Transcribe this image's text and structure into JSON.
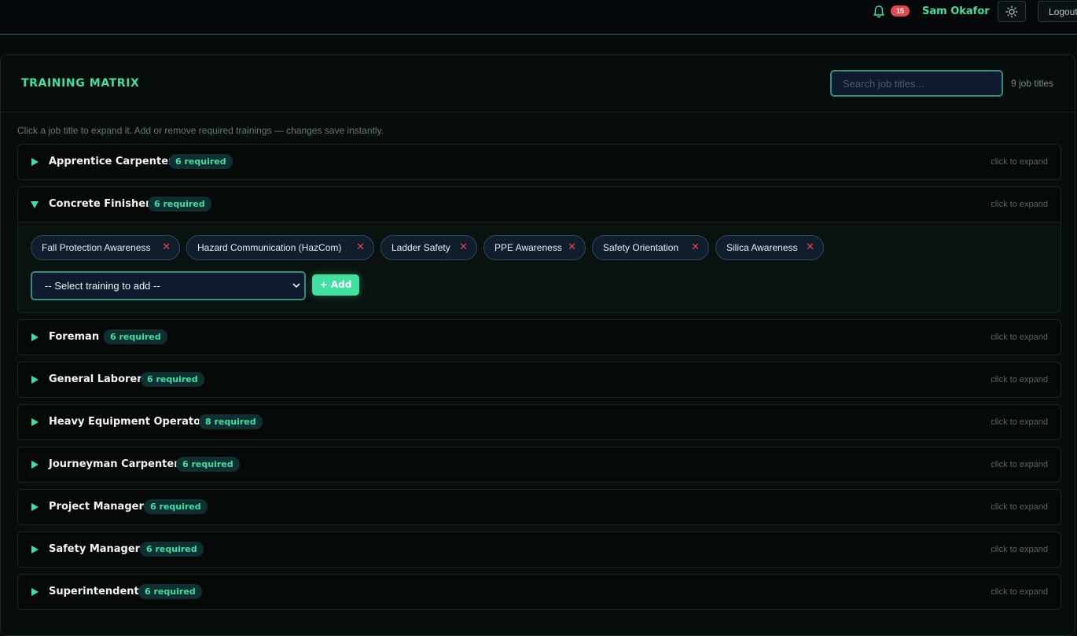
{
  "header": {
    "notification_count": "15",
    "user_name": "Sam Okafor",
    "logout_label": "Logout",
    "accent_color": "#3fe0a0",
    "badge_color": "#e5484d",
    "icons": [
      "bell-icon",
      "sun-icon"
    ]
  },
  "matrix": {
    "title": "TRAINING MATRIX",
    "search_placeholder": "Search job titles...",
    "count_label": "9 job titles",
    "hint": "Click a job title to expand it. Add or remove required trainings — changes save instantly.",
    "expand_hint": "click to expand",
    "jobs": [
      {
        "name": "Apprentice Carpenter",
        "required": "6 required",
        "expanded": false
      },
      {
        "name": "Concrete Finisher",
        "required": "6 required",
        "expanded": true
      },
      {
        "name": "Foreman",
        "required": "6 required",
        "expanded": false
      },
      {
        "name": "General Laborer",
        "required": "6 required",
        "expanded": false
      },
      {
        "name": "Heavy Equipment Operator",
        "required": "8 required",
        "expanded": false
      },
      {
        "name": "Journeyman Carpenter",
        "required": "6 required",
        "expanded": false
      },
      {
        "name": "Project Manager",
        "required": "6 required",
        "expanded": false
      },
      {
        "name": "Safety Manager",
        "required": "6 required",
        "expanded": false
      },
      {
        "name": "Superintendent",
        "required": "6 required",
        "expanded": false
      }
    ],
    "expanded_job": {
      "trainings": [
        "Fall Protection Awareness",
        "Hazard Communication (HazCom)",
        "Ladder Safety",
        "PPE Awareness",
        "Safety Orientation",
        "Silica Awareness"
      ],
      "remove_glyph": "✕",
      "select_value": "-- Select training to add --",
      "add_label": "+ Add"
    }
  }
}
